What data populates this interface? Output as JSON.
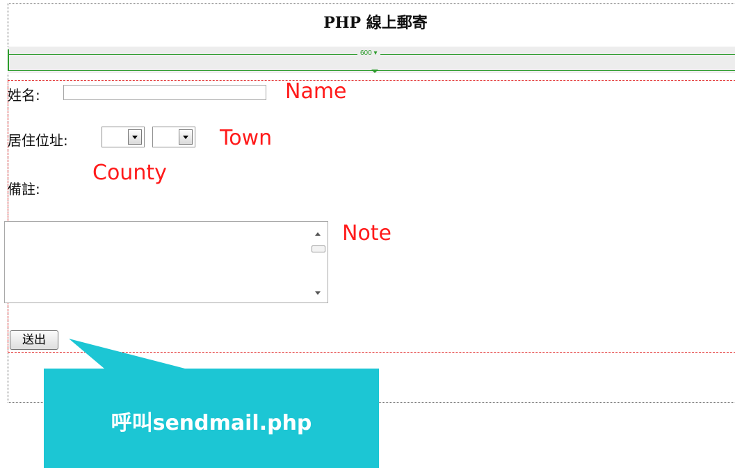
{
  "page": {
    "title": "PHP 線上郵寄"
  },
  "ruler": {
    "width_label": "600"
  },
  "form": {
    "name_label": "姓名:",
    "address_label": "居住位址:",
    "note_label": "備註:",
    "name_value": "",
    "county_value": "",
    "town_value": "",
    "submit_label": "送出"
  },
  "annotations": {
    "name": "Name",
    "town": "Town",
    "county": "County",
    "note": "Note",
    "callout": "呼叫sendmail.php"
  },
  "colors": {
    "annotation": "#ff1a1a",
    "callout": "#1cc6d4",
    "ruler": "#2b9b2b",
    "box_outline": "#e02020"
  }
}
